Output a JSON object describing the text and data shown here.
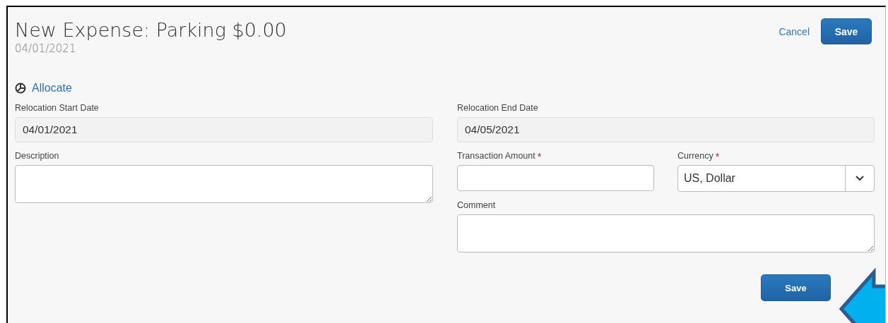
{
  "header": {
    "title": "New Expense: Parking $0.00",
    "date": "04/01/2021",
    "cancel": "Cancel",
    "save": "Save"
  },
  "allocate": {
    "label": "Allocate"
  },
  "left_fields": [
    {
      "kind": "readonly",
      "label": "Relocation Start Date",
      "value": "04/01/2021"
    },
    {
      "kind": "textarea",
      "label": "Description"
    }
  ],
  "right_fields": [
    {
      "kind": "readonly",
      "label": "Relocation End Date",
      "value": "04/05/2021"
    },
    {
      "kind": "text",
      "label": "Transaction Amount",
      "required_mark": "*"
    },
    {
      "kind": "select",
      "label": "Currency",
      "value": "US, Dollar",
      "required_mark": "*"
    },
    {
      "kind": "textarea",
      "label": "Comment"
    }
  ],
  "footer": {
    "save": "Save"
  }
}
